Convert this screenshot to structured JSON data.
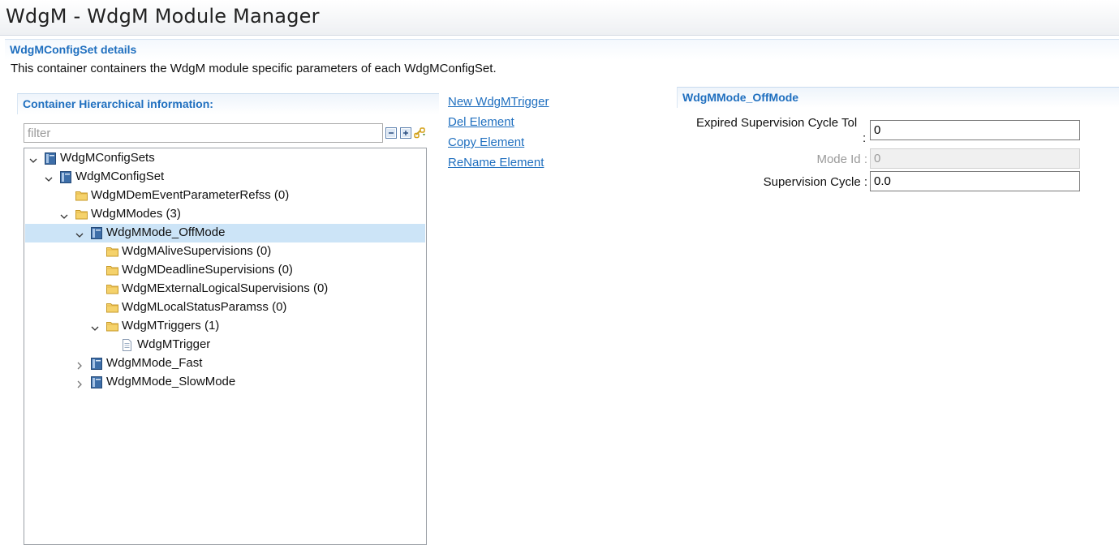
{
  "window": {
    "title": "WdgM - WdgM Module Manager"
  },
  "section": {
    "title": "WdgMConfigSet details",
    "description": "This container containers the WdgM module specific parameters of each WdgMConfigSet."
  },
  "left_panel": {
    "title": "Container Hierarchical information:",
    "filter": {
      "placeholder": "filter",
      "value": ""
    },
    "tools": [
      "collapse-all-icon",
      "expand-all-icon",
      "link-with-editor-icon"
    ]
  },
  "tree": [
    {
      "label": "WdgMConfigSets",
      "level": 0,
      "icon": "container-icon",
      "twisty": "expanded",
      "selected": false
    },
    {
      "label": "WdgMConfigSet",
      "level": 1,
      "icon": "container-icon",
      "twisty": "expanded",
      "selected": false
    },
    {
      "label": "WdgMDemEventParameterRefss (0)",
      "level": 2,
      "icon": "folder-icon",
      "twisty": "none",
      "selected": false
    },
    {
      "label": "WdgMModes (3)",
      "level": 2,
      "icon": "folder-icon",
      "twisty": "expanded",
      "selected": false
    },
    {
      "label": "WdgMMode_OffMode",
      "level": 3,
      "icon": "container-icon",
      "twisty": "expanded",
      "selected": true
    },
    {
      "label": "WdgMAliveSupervisions (0)",
      "level": 4,
      "icon": "folder-icon",
      "twisty": "none",
      "selected": false
    },
    {
      "label": "WdgMDeadlineSupervisions (0)",
      "level": 4,
      "icon": "folder-icon",
      "twisty": "none",
      "selected": false
    },
    {
      "label": "WdgMExternalLogicalSupervisions (0)",
      "level": 4,
      "icon": "folder-icon",
      "twisty": "none",
      "selected": false
    },
    {
      "label": "WdgMLocalStatusParamss (0)",
      "level": 4,
      "icon": "folder-icon",
      "twisty": "none",
      "selected": false
    },
    {
      "label": "WdgMTriggers (1)",
      "level": 4,
      "icon": "folder-icon",
      "twisty": "expanded",
      "selected": false
    },
    {
      "label": "WdgMTrigger",
      "level": 5,
      "icon": "file-icon",
      "twisty": "none",
      "selected": false
    },
    {
      "label": "WdgMMode_Fast",
      "level": 3,
      "icon": "container-icon",
      "twisty": "collapsed",
      "selected": false
    },
    {
      "label": "WdgMMode_SlowMode",
      "level": 3,
      "icon": "container-icon",
      "twisty": "collapsed",
      "selected": false
    }
  ],
  "actions": {
    "new": "New WdgMTrigger",
    "delete": "Del Element",
    "copy": "Copy Element",
    "rename": "ReName Element"
  },
  "right_panel": {
    "title": "WdgMMode_OffMode",
    "fields": {
      "expired": {
        "label_line1": "Expired Supervision Cycle Tol",
        "label_line2": ":",
        "value": "0"
      },
      "mode_id": {
        "label": "Mode Id :",
        "value": "0"
      },
      "cycle": {
        "label": "Supervision Cycle :",
        "value": "0.0"
      }
    }
  },
  "colors": {
    "accent": "#1f6fbf",
    "selection": "#cce4f7",
    "folder": "#f5d26b",
    "container_icon": "#3d6ea8"
  }
}
